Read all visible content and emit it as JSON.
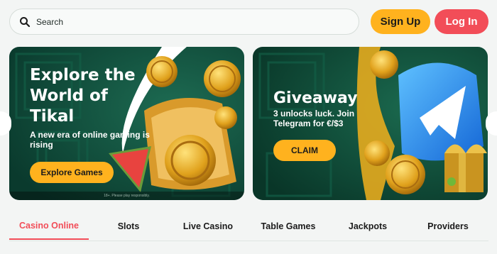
{
  "header": {
    "search_placeholder": "Search",
    "signup_label": "Sign Up",
    "login_label": "Log In"
  },
  "banners": [
    {
      "title": "Explore the World of Tikal",
      "subtitle": "A new era of online gaming is rising",
      "cta": "Explore Games",
      "disclaimer": "18+. Please play responsibly."
    },
    {
      "title": "Giveaway",
      "subtitle": "3 unlocks luck. Join Telegram for €/$3",
      "cta": "CLAIM"
    }
  ],
  "tabs": [
    {
      "label": "Casino Online",
      "active": true
    },
    {
      "label": "Slots"
    },
    {
      "label": "Live Casino"
    },
    {
      "label": "Table Games"
    },
    {
      "label": "Jackpots"
    },
    {
      "label": "Providers"
    }
  ],
  "colors": {
    "accent": "#f24d58",
    "cta": "#ffb21e",
    "banner_bg": "#0e4a3a"
  },
  "icons": [
    "search-icon",
    "chevron-left-icon",
    "chevron-right-icon"
  ]
}
